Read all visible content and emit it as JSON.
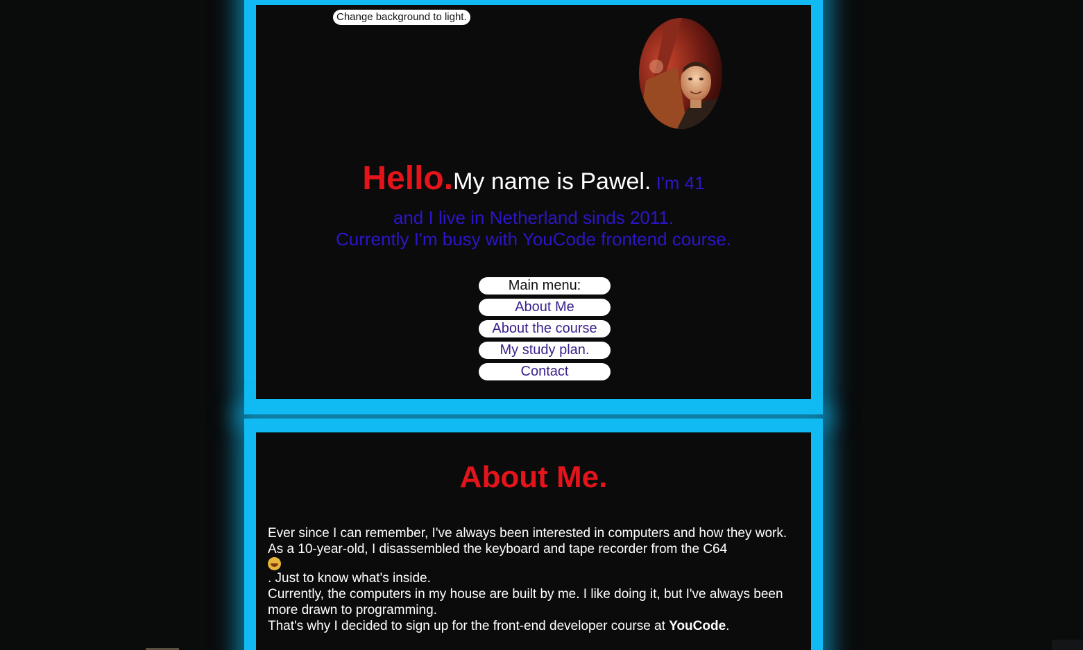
{
  "theme_toggle": {
    "label": "Change background to light."
  },
  "avatar": {
    "alt": "Portrait of Pawel"
  },
  "greeting": {
    "hello": "Hello.",
    "name": "My name is Pawel.",
    "age": " I'm 41",
    "line2": "and I live in Netherland sinds 2011.",
    "line3": "Currently I'm busy with YouCode frontend course."
  },
  "menu": {
    "heading": "Main menu:",
    "items": [
      {
        "label": "About Me"
      },
      {
        "label": "About the course"
      },
      {
        "label": "My study plan."
      },
      {
        "label": "Contact"
      }
    ]
  },
  "about": {
    "title": "About Me.",
    "p1": "Ever since I can remember, I've always been interested in computers and how they work.",
    "p2_start": "As a 10-year-old, I disassembled the keyboard and tape recorder from the C64",
    "p2_end": ". Just to know what's inside.",
    "p3": "Currently, the computers in my house are built by me. I like doing it, but I've always been more drawn to programming.",
    "p4_start": "That's why I decided to sign up for the front-end developer course at ",
    "p4_brand": "YouCode",
    "p4_end": "."
  },
  "colors": {
    "background": "#0a0b0b",
    "frame": "#11baf2",
    "accent_red": "#e4141b",
    "accent_blue": "#2b16c9",
    "menu_text": "#3a1f8c"
  }
}
